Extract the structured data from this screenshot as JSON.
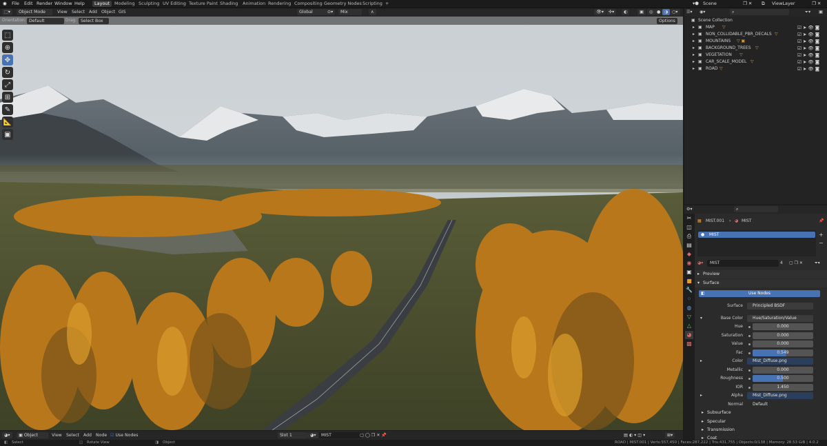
{
  "topbar": {
    "menus": [
      "File",
      "Edit",
      "Render",
      "Window",
      "Help"
    ],
    "workspaces": [
      "Layout",
      "Modeling",
      "Sculpting",
      "UV Editing",
      "Texture Paint",
      "Shading",
      "Animation",
      "Rendering",
      "Compositing",
      "Geometry Nodes",
      "Scripting"
    ],
    "active_workspace": "Layout",
    "add_tab": "+",
    "scene_label": "Scene",
    "view_layer_label": "ViewLayer"
  },
  "viewport": {
    "mode": "Object Mode",
    "menus": [
      "View",
      "Select",
      "Add",
      "Object",
      "GIS"
    ],
    "transform_orientation": "Global",
    "pivot": "Mix",
    "orientation_label": "Orientation:",
    "orientation_value": "Default",
    "drag_label": "Drag:",
    "drag_value": "Select Box",
    "options_label": "Options"
  },
  "outliner": {
    "collection": "Scene Collection",
    "items": [
      "MAP",
      "NON_COLLIDABLE_PBR_DECALS",
      "MOUNTAINS",
      "BACKGROUND_TREES",
      "VEGETATION",
      "CAR_SCALE_MODEL",
      "ROAD"
    ]
  },
  "properties": {
    "breadcrumb_object": "MIST.001",
    "breadcrumb_material": "MIST",
    "slot_name": "MIST",
    "material_name": "MIST",
    "user_count": "4",
    "preview_label": "Preview",
    "surface_section": "Surface",
    "use_nodes_label": "Use Nodes",
    "surface_label": "Surface",
    "surface_value": "Principled BSDF",
    "base_color_label": "Base Color",
    "base_color_value": "Hue/Saturation/Value",
    "hue_label": "Hue",
    "hue_value": "0.000",
    "saturation_label": "Saturation",
    "saturation_value": "0.000",
    "value_label": "Value",
    "value_value": "0.000",
    "fac_label": "Fac",
    "fac_value": "0.549",
    "color_label": "Color",
    "color_value": "Mist_Diffuse.png",
    "metallic_label": "Metallic",
    "metallic_value": "0.000",
    "roughness_label": "Roughness",
    "roughness_value": "0.500",
    "ior_label": "IOR",
    "ior_value": "1.450",
    "alpha_label": "Alpha",
    "alpha_value": "Mist_Diffuse.png",
    "normal_label": "Normal",
    "normal_value": "Default",
    "subsurface_label": "Subsurface",
    "specular_label": "Specular",
    "transmission_label": "Transmission",
    "coat_label": "Coat"
  },
  "node_editor": {
    "mode": "Object",
    "menus": [
      "View",
      "Select",
      "Add",
      "Node"
    ],
    "use_nodes_label": "Use Nodes",
    "slot_label": "Slot 1",
    "material": "MIST"
  },
  "statusbar": {
    "select": "Select",
    "rotate": "Rotate View",
    "object": "Object",
    "stats": "ROAD | MIST.001 | Verts:557,450 | Faces:287,222 | Tris:431,755 | Objects:0/138 | Memory: 28.53 GiB | 4.0.2"
  },
  "colors": {
    "accent": "#4772b3",
    "panel": "#2b2b2b",
    "header": "#262626"
  }
}
